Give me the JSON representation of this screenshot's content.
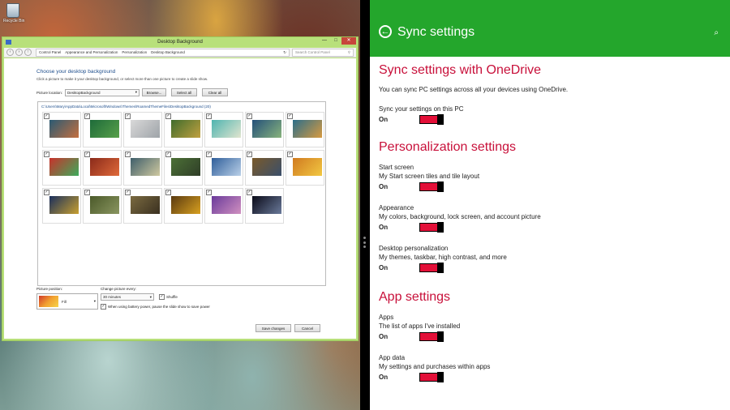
{
  "desktop": {
    "recycle_label": "Recycle Bin",
    "window": {
      "title": "Desktop Background",
      "minimize": "—",
      "maximize": "□",
      "close": "✕",
      "address": {
        "back": "‹",
        "forward": "›",
        "up": "↑",
        "crumbs": [
          "Control Panel",
          "Appearance and Personalization",
          "Personalization",
          "Desktop Background"
        ],
        "refresh": "↻",
        "search_placeholder": "Search Control Panel"
      },
      "heading": "Choose your desktop background",
      "subheading": "Click a picture to make it your desktop background, or select more than one picture to create a slide show.",
      "picture_location_label": "Picture location:",
      "picture_location_value": "DesktopBackground",
      "browse_label": "Browse...",
      "select_all_label": "Select all",
      "clear_all_label": "Clear all",
      "folder_path": "C:\\Users\\Mary\\AppData\\Local\\Microsoft\\Windows\\Themes\\RoamedThemeFiles\\DesktopBackground (20)",
      "thumbnails": [
        {
          "c1": "#2a5a73",
          "c2": "#c46f3f"
        },
        {
          "c1": "#1e6b3a",
          "c2": "#58a04a"
        },
        {
          "c1": "#d9d9d9",
          "c2": "#9ea3a8"
        },
        {
          "c1": "#3f6c2c",
          "c2": "#c0a040"
        },
        {
          "c1": "#4fb4b0",
          "c2": "#e1e5cf"
        },
        {
          "c1": "#24507a",
          "c2": "#88b37c"
        },
        {
          "c1": "#2b6e8a",
          "c2": "#d79a40"
        },
        {
          "c1": "#c8322b",
          "c2": "#3dab5b"
        },
        {
          "c1": "#8a2a1a",
          "c2": "#e06a3a"
        },
        {
          "c1": "#3e5e6a",
          "c2": "#cfc9a0"
        },
        {
          "c1": "#4c7036",
          "c2": "#2f3e28"
        },
        {
          "c1": "#2f5e9a",
          "c2": "#b9d0e8"
        },
        {
          "c1": "#7a5a2a",
          "c2": "#3a4f6b"
        },
        {
          "c1": "#d07a20",
          "c2": "#f2c842"
        },
        {
          "c1": "#1a2f5c",
          "c2": "#c8a030"
        },
        {
          "c1": "#4b5a2a",
          "c2": "#8a9560"
        },
        {
          "c1": "#7a6a40",
          "c2": "#3a3020"
        },
        {
          "c1": "#5a3a10",
          "c2": "#d8a020"
        },
        {
          "c1": "#6a3a9a",
          "c2": "#d090c0"
        },
        {
          "c1": "#0a0a18",
          "c2": "#6a7a9a"
        }
      ],
      "check_mark": "✓",
      "picture_position_label": "Picture position:",
      "picture_position_value": "Fill",
      "change_every_label": "Change picture every:",
      "change_every_value": "30 minutes",
      "shuffle_label": "Shuffle",
      "battery_label": "When using battery power, pause the slide show to save power",
      "save_label": "Save changes",
      "cancel_label": "Cancel",
      "dropdown_arrow": "▾"
    }
  },
  "settings": {
    "title": "Sync settings",
    "back_glyph": "←",
    "search_glyph": "⌕",
    "sections": {
      "onedrive": {
        "heading": "Sync settings with OneDrive",
        "description": "You can sync PC settings across all your devices using OneDrive.",
        "item_label": "Sync your settings on this PC",
        "state": "On"
      },
      "personalization": {
        "heading": "Personalization settings",
        "items": [
          {
            "name": "Start screen",
            "detail": "My Start screen tiles and tile layout",
            "state": "On"
          },
          {
            "name": "Appearance",
            "detail": "My colors, background, lock screen, and account picture",
            "state": "On"
          },
          {
            "name": "Desktop personalization",
            "detail": "My themes, taskbar, high contrast, and more",
            "state": "On"
          }
        ]
      },
      "app": {
        "heading": "App settings",
        "items": [
          {
            "name": "Apps",
            "detail": "The list of apps I've installed",
            "state": "On"
          },
          {
            "name": "App data",
            "detail": "My settings and purchases within apps",
            "state": "On"
          }
        ]
      }
    }
  }
}
